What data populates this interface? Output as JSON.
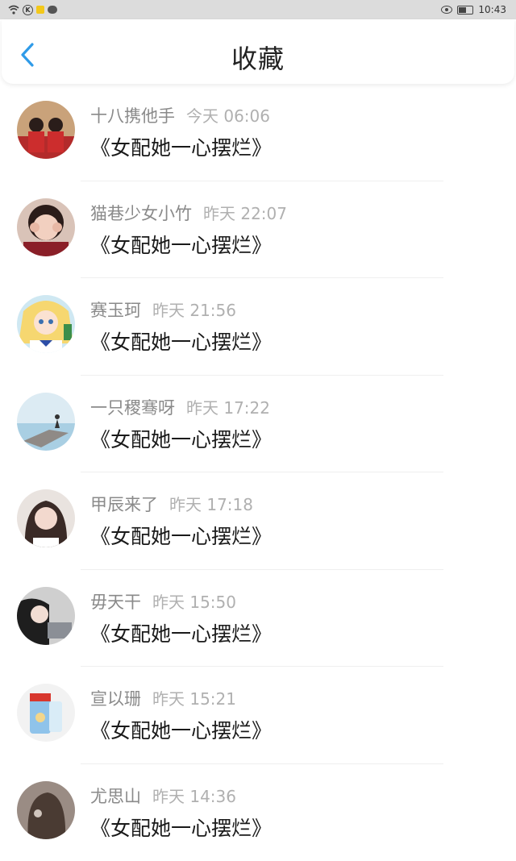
{
  "status_bar": {
    "time": "10:43",
    "k_icon": "K"
  },
  "header": {
    "title": "收藏"
  },
  "favorites": [
    {
      "name": "十八携他手",
      "time": "今天 06:06",
      "title": "《女配她一心摆烂》"
    },
    {
      "name": "猫巷少女小竹",
      "time": "昨天 22:07",
      "title": "《女配她一心摆烂》"
    },
    {
      "name": "赛玉珂",
      "time": "昨天 21:56",
      "title": "《女配她一心摆烂》"
    },
    {
      "name": "一只稷骞呀",
      "time": "昨天 17:22",
      "title": "《女配她一心摆烂》"
    },
    {
      "name": "甲辰来了",
      "time": "昨天 17:18",
      "title": "《女配她一心摆烂》"
    },
    {
      "name": "毋天干",
      "time": "昨天 15:50",
      "title": "《女配她一心摆烂》"
    },
    {
      "name": "宣以珊",
      "time": "昨天 15:21",
      "title": "《女配她一心摆烂》"
    },
    {
      "name": "尤思山",
      "time": "昨天 14:36",
      "title": "《女配她一心摆烂》"
    }
  ],
  "colors": {
    "accent": "#2f9be8",
    "title_text": "#1a1a1a",
    "meta_text": "#8a8a8a"
  }
}
